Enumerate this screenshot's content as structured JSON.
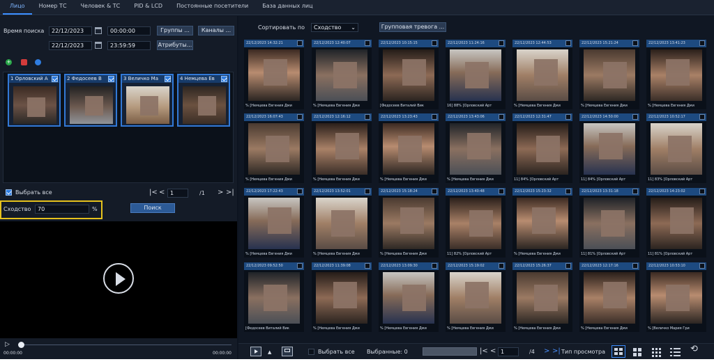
{
  "tabs": [
    {
      "label": "Лицо",
      "active": true
    },
    {
      "label": "Номер ТС",
      "active": false
    },
    {
      "label": "Человек & ТС",
      "active": false
    },
    {
      "label": "PID & LCD",
      "active": false
    },
    {
      "label": "Постоянные посетители",
      "active": false
    },
    {
      "label": "База данных лиц",
      "active": false
    }
  ],
  "search": {
    "time_label": "Время поиска",
    "start_date": "22/12/2023",
    "start_time": "00:00:00",
    "end_date": "22/12/2023",
    "end_time": "23:59:59",
    "groups_button": "Группы ...",
    "channels_button": "Каналы ...",
    "attributes_button": "Атрибуты..."
  },
  "selected_faces": [
    {
      "label": "1 Орловский А"
    },
    {
      "label": "2 Федосеев В"
    },
    {
      "label": "3 Величко Ма"
    },
    {
      "label": "4 Немцева Ев"
    }
  ],
  "select_all": {
    "label": "Выбрать все",
    "checked": true
  },
  "left_pager": {
    "page": "1",
    "total": "/1"
  },
  "similarity": {
    "label": "Сходство",
    "value": "70",
    "unit": "%"
  },
  "search_button": "Поиск",
  "timeline": {
    "start": "00:00:00",
    "end": "00:00:00"
  },
  "sort": {
    "label": "Сортировать по",
    "value": "Сходство"
  },
  "group_alarm_button": "Групповая тревога ...",
  "results": [
    {
      "ts": "22/12/2023 14:32:21",
      "caption": "% [Немцева Евгения Дми"
    },
    {
      "ts": "22/12/2023 12:40:07",
      "caption": "% [Немцева Евгения Дми"
    },
    {
      "ts": "22/12/2023 10:15:15",
      "caption": "[Федосеев Виталий Вик"
    },
    {
      "ts": "22/12/2023 11:24:16",
      "caption": "16] 88% [Орловский Арт"
    },
    {
      "ts": "22/12/2023 12:44:53",
      "caption": "% [Немцева Евгения Дми"
    },
    {
      "ts": "22/12/2023 15:21:24",
      "caption": "% [Немцева Евгения Дми"
    },
    {
      "ts": "22/12/2023 13:41:23",
      "caption": "% [Немцева Евгения Дми"
    },
    {
      "ts": "22/12/2023 16:07:43",
      "caption": "% [Немцева Евгения Дми"
    },
    {
      "ts": "22/12/2023 12:16:12",
      "caption": "% [Немцева Евгения Дми"
    },
    {
      "ts": "22/12/2023 13:23:43",
      "caption": "% [Немцева Евгения Дми"
    },
    {
      "ts": "22/12/2023 13:43:06",
      "caption": "% [Немцева Евгения Дми"
    },
    {
      "ts": "22/12/2023 12:31:47",
      "caption": "11] 84% [Орловский Арт"
    },
    {
      "ts": "22/12/2023 14:50:00",
      "caption": "11] 84% [Орловский Арт"
    },
    {
      "ts": "22/12/2023 10:52:17",
      "caption": "11] 83% [Орловский Арт"
    },
    {
      "ts": "22/12/2023 17:22:43",
      "caption": "% [Немцева Евгения Дми"
    },
    {
      "ts": "22/12/2023 13:52:01",
      "caption": "% [Немцева Евгения Дми"
    },
    {
      "ts": "22/12/2023 15:18:24",
      "caption": "% [Немцева Евгения Дми"
    },
    {
      "ts": "22/12/2023 13:40:48",
      "caption": "11] 82% [Орловский Арт"
    },
    {
      "ts": "22/12/2023 15:23:32",
      "caption": "% [Немцева Евгения Дми"
    },
    {
      "ts": "22/12/2023 13:31:18",
      "caption": "11] 81% [Орловский Арт"
    },
    {
      "ts": "22/12/2023 14:23:02",
      "caption": "11] 81% [Орловский Арт"
    },
    {
      "ts": "22/12/2023 09:52:50",
      "caption": "[Федосеев Виталий Вик"
    },
    {
      "ts": "22/12/2023 11:39:08",
      "caption": "% [Немцева Евгения Дми"
    },
    {
      "ts": "22/12/2023 13:09:30",
      "caption": "% [Немцева Евгения Дми"
    },
    {
      "ts": "22/12/2023 15:19:02",
      "caption": "% [Немцева Евгения Дми"
    },
    {
      "ts": "22/12/2023 15:26:37",
      "caption": "% [Немцева Евгения Дми"
    },
    {
      "ts": "22/12/2023 12:17:16",
      "caption": "% [Немцева Евгения Дми"
    },
    {
      "ts": "22/12/2023 10:53:10",
      "caption": "% [Величко Мария Гри"
    }
  ],
  "bottom": {
    "select_all": "Выбрать все",
    "selected": "Выбранные: 0",
    "page": "1",
    "total": "/4",
    "view_label": "Тип просмотра"
  },
  "colors": {
    "accent": "#3a8dff",
    "highlight": "#e6c21d",
    "face_blur": "#8c7366"
  }
}
